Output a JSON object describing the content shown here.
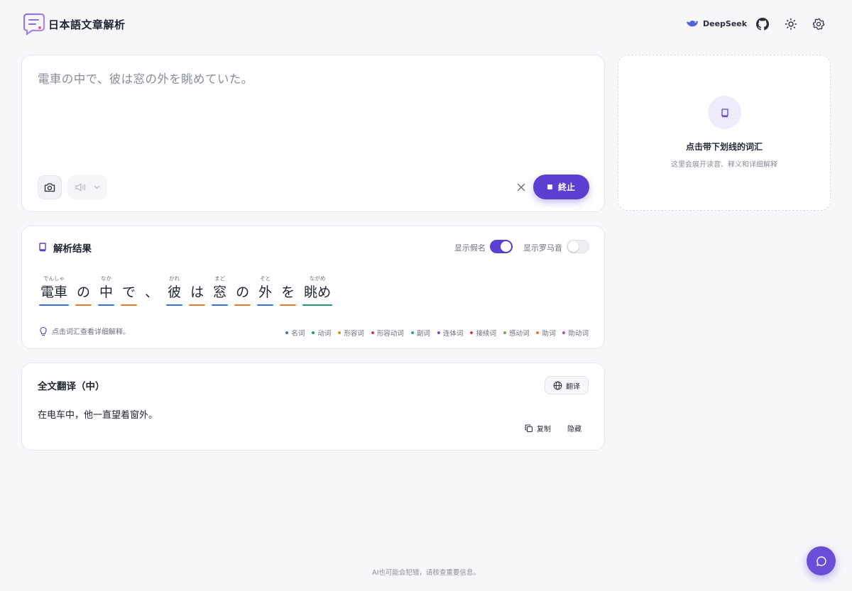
{
  "header": {
    "app_title": "日本語文章解析",
    "model_name": "DeepSeek",
    "icons": [
      "github-icon",
      "sun-icon",
      "gear-icon"
    ]
  },
  "input": {
    "text": "電車の中で、彼は窓の外を眺めていた。",
    "stop_label": "終止"
  },
  "side_panel": {
    "title": "点击带下划线的词汇",
    "subtitle": "这里会展开读音、释义和详细解释"
  },
  "result": {
    "title": "解析结果",
    "toggle_kana_label": "显示假名",
    "toggle_kana_on": true,
    "toggle_romaji_label": "显示罗马音",
    "toggle_romaji_on": false,
    "hint": "点击词汇查看详细解释。",
    "words": [
      {
        "surface": "電車",
        "ruby": "でんしゃ",
        "pos": "noun"
      },
      {
        "surface": "の",
        "ruby": "",
        "pos": "particle"
      },
      {
        "surface": "中",
        "ruby": "なか",
        "pos": "noun"
      },
      {
        "surface": "で",
        "ruby": "",
        "pos": "particle"
      },
      {
        "surface": "、",
        "ruby": "",
        "pos": "punct"
      },
      {
        "surface": "彼",
        "ruby": "かれ",
        "pos": "noun"
      },
      {
        "surface": "は",
        "ruby": "",
        "pos": "particle"
      },
      {
        "surface": "窓",
        "ruby": "まど",
        "pos": "noun"
      },
      {
        "surface": "の",
        "ruby": "",
        "pos": "particle"
      },
      {
        "surface": "外",
        "ruby": "そと",
        "pos": "noun"
      },
      {
        "surface": "を",
        "ruby": "",
        "pos": "particle"
      },
      {
        "surface": "眺め",
        "ruby": "ながめ",
        "pos": "verb"
      }
    ],
    "legend": [
      {
        "label": "名词",
        "color": "#3b6fd8"
      },
      {
        "label": "动词",
        "color": "#1a9b6c"
      },
      {
        "label": "形容词",
        "color": "#e08a1e"
      },
      {
        "label": "形容动词",
        "color": "#d6336c"
      },
      {
        "label": "副词",
        "color": "#12a59a"
      },
      {
        "label": "连体词",
        "color": "#7b4dd8"
      },
      {
        "label": "接续词",
        "color": "#d63a3a"
      },
      {
        "label": "感动词",
        "color": "#6bb33a"
      },
      {
        "label": "助词",
        "color": "#e8772e"
      },
      {
        "label": "助动词",
        "color": "#b04ac0"
      }
    ],
    "pos_colors": {
      "noun": "#3b6fd8",
      "verb": "#1a9b6c",
      "particle": "#e8772e",
      "punct": "transparent"
    }
  },
  "translation": {
    "title": "全文翻译（中）",
    "translate_label": "翻译",
    "text": "在电车中，他一直望着窗外。",
    "copy_label": "复制",
    "hide_label": "隐藏"
  },
  "footer": {
    "disclaimer": "AI也可能会犯错，请核查重要信息。"
  },
  "colors": {
    "accent": "#5b3fd0"
  }
}
